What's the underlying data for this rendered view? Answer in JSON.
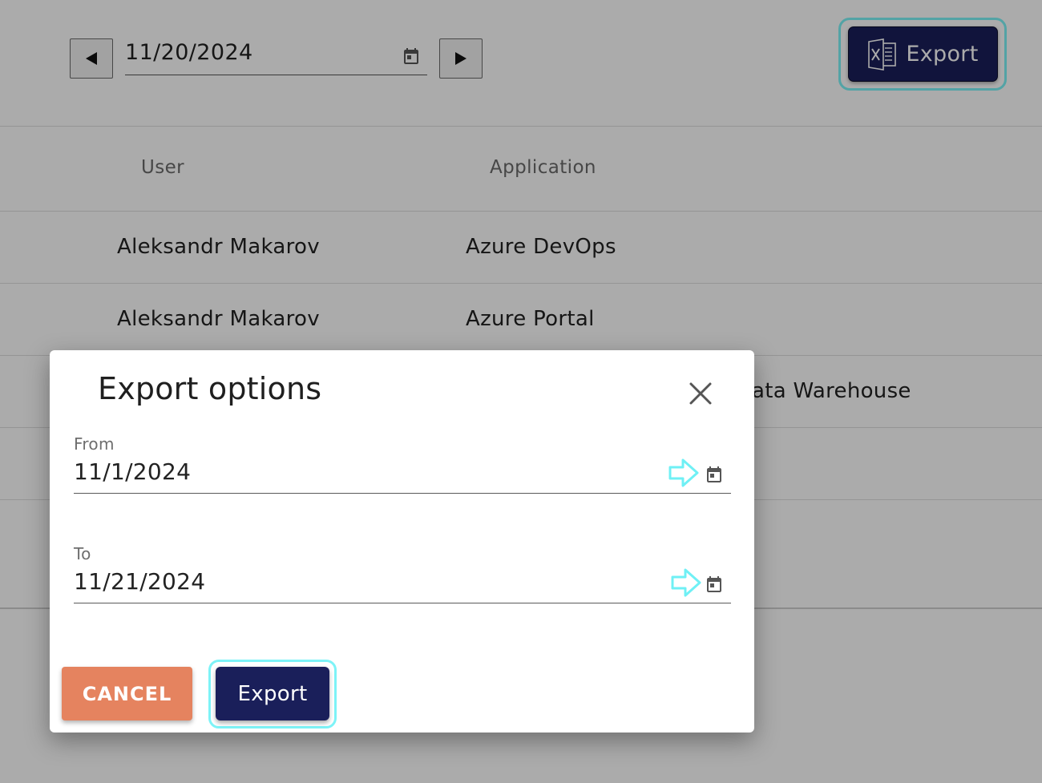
{
  "toolbar": {
    "date_value": "11/20/2024",
    "prev_icon": "triangle-left-icon",
    "next_icon": "triangle-right-icon",
    "calendar_icon": "calendar-icon",
    "export_label": "Export",
    "export_icon": "excel-icon"
  },
  "table": {
    "columns": [
      "User",
      "Application"
    ],
    "rows": [
      [
        "Aleksandr Makarov",
        "Azure DevOps"
      ],
      [
        "Aleksandr Makarov",
        "Azure Portal"
      ],
      [
        "",
        "ata Warehouse"
      ]
    ]
  },
  "dialog": {
    "title": "Export options",
    "close_icon": "close-icon",
    "from_label": "From",
    "from_value": "11/1/2024",
    "to_label": "To",
    "to_value": "11/21/2024",
    "hint_icon": "arrow-right-outline-icon",
    "cancel_label": "CANCEL",
    "export_label": "Export"
  },
  "colors": {
    "navy": "#1a1f5a",
    "highlight": "#7df3f7",
    "cancel": "#e5835f",
    "overlay": "rgba(0,0,0,0.33)"
  }
}
